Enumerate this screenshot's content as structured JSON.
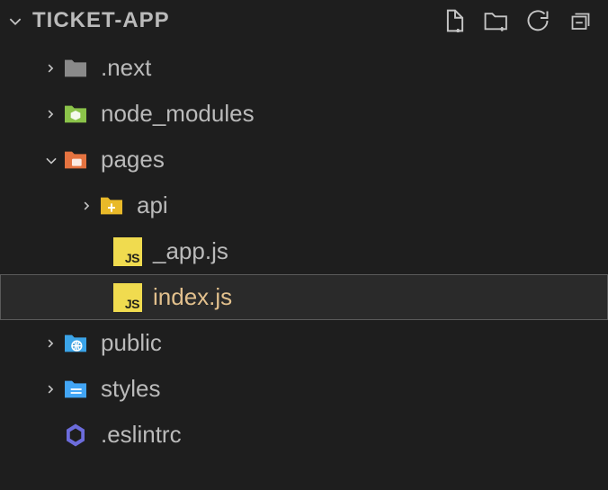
{
  "project": {
    "name": "TICKET-APP"
  },
  "actions": {
    "newFile": "New File",
    "newFolder": "New Folder",
    "refresh": "Refresh Explorer",
    "collapseAll": "Collapse All"
  },
  "tree": {
    "items": [
      {
        "label": ".next",
        "icon": "folder-gray",
        "depth": 1,
        "expandable": true,
        "expanded": false
      },
      {
        "label": "node_modules",
        "icon": "folder-green-hex",
        "depth": 1,
        "expandable": true,
        "expanded": false
      },
      {
        "label": "pages",
        "icon": "folder-orange",
        "depth": 1,
        "expandable": true,
        "expanded": true
      },
      {
        "label": "api",
        "icon": "folder-yellow-plus",
        "depth": 2,
        "expandable": true,
        "expanded": false
      },
      {
        "label": "_app.js",
        "icon": "js",
        "depth": 3,
        "expandable": false
      },
      {
        "label": "index.js",
        "icon": "js",
        "depth": 3,
        "expandable": false,
        "selected": true
      },
      {
        "label": "public",
        "icon": "folder-blue-globe",
        "depth": 1,
        "expandable": true,
        "expanded": false
      },
      {
        "label": "styles",
        "icon": "folder-lightblue-lines",
        "depth": 1,
        "expandable": true,
        "expanded": false
      },
      {
        "label": ".eslintrc",
        "icon": "eslint-hex",
        "depth": 1,
        "expandable": false
      }
    ]
  }
}
